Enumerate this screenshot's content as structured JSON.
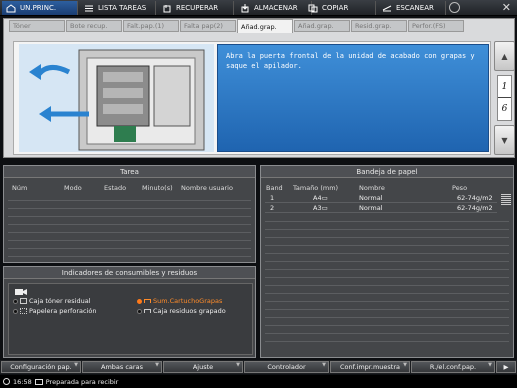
{
  "topbar": {
    "items": [
      {
        "label": "UN.PRINC.",
        "icon": "home-icon"
      },
      {
        "label": "LISTA TAREAS",
        "icon": "list-icon"
      },
      {
        "label": "RECUPERAR",
        "icon": "recall-icon"
      },
      {
        "label": "ALMACENAR",
        "icon": "store-icon"
      },
      {
        "label": "COPIAR",
        "icon": "copy-icon"
      },
      {
        "label": "ESCANEAR",
        "icon": "scan-icon"
      }
    ],
    "close_glyph": "✕"
  },
  "tabs": [
    "Tóner",
    "Bote recup.",
    "Falt.pap.(1)",
    "Falta pap(2)",
    "Añad.grap.",
    "Añad.grap.",
    "Resid.grap.",
    "Perfor.(FS)"
  ],
  "guide": {
    "message": "Abra la puerta frontal de la unidad de acabado con grapas y saque el apilador.",
    "page_current": "1",
    "page_total": "6",
    "up_arrow": "▲",
    "down_arrow": "▼"
  },
  "tarea": {
    "title": "Tarea",
    "columns": [
      "Núm",
      "Modo",
      "Estado",
      "Minuto(s)",
      "Nombre usuario"
    ]
  },
  "bandeja": {
    "title": "Bandeja de papel",
    "columns": [
      "Band",
      "Tamaño (mm)",
      "Nombre",
      "Peso"
    ],
    "rows": [
      {
        "band": "1",
        "size": "A4▭",
        "name": "Normal",
        "weight": "62-74g/m2"
      },
      {
        "band": "2",
        "size": "A3▭",
        "name": "Normal",
        "weight": "62-74g/m2"
      }
    ]
  },
  "consumibles": {
    "title": "Indicadores de consumibles y residuos",
    "items": [
      {
        "label": "Caja tóner residual",
        "state": "off"
      },
      {
        "label": "Papelera perforación",
        "state": "off"
      },
      {
        "label": "Sum.CartuchoGrapas",
        "state": "warn"
      },
      {
        "label": "Caja residuos grapado",
        "state": "off"
      }
    ]
  },
  "bottom": {
    "buttons": [
      "Configuración pap.",
      "Ambas caras",
      "Ajuste",
      "Controlador",
      "Conf.impr.muestra",
      "R./el.conf.pap."
    ],
    "more_glyph": "▶"
  },
  "status": {
    "time": "16:58",
    "text": "Preparada para recibir"
  },
  "colors": {
    "active_tab_blue": "#2d5fa0",
    "message_blue": "#2a74c4",
    "warning_orange": "#ff7a1a"
  }
}
